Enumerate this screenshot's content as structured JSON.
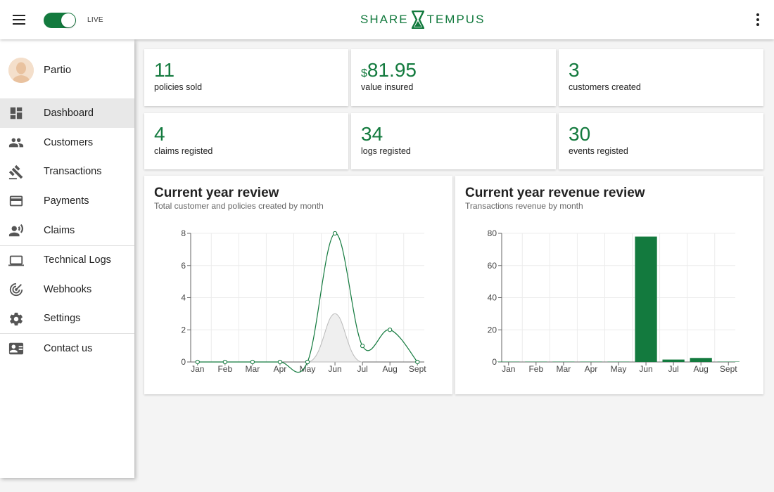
{
  "header": {
    "live_label": "LIVE",
    "logo_left": "SHARE",
    "logo_right": "TEMPUS",
    "live_enabled": true,
    "brand_color": "#137a3e"
  },
  "sidebar": {
    "user_name": "Partio",
    "items": [
      {
        "label": "Dashboard",
        "icon": "dashboard-icon",
        "active": true
      },
      {
        "label": "Customers",
        "icon": "people-icon"
      },
      {
        "label": "Transactions",
        "icon": "gavel-icon"
      },
      {
        "label": "Payments",
        "icon": "credit-card-icon"
      },
      {
        "label": "Claims",
        "icon": "record-voice-icon"
      },
      {
        "label": "Technical Logs",
        "icon": "laptop-icon"
      },
      {
        "label": "Webhooks",
        "icon": "webhook-icon"
      },
      {
        "label": "Settings",
        "icon": "gear-icon"
      },
      {
        "label": "Contact us",
        "icon": "contact-card-icon"
      }
    ]
  },
  "stats": [
    {
      "value": "11",
      "label": "policies sold"
    },
    {
      "currency": "$",
      "value": "81.95",
      "label": "value insured"
    },
    {
      "value": "3",
      "label": "customers created"
    },
    {
      "value": "4",
      "label": "claims registed"
    },
    {
      "value": "34",
      "label": "logs registed"
    },
    {
      "value": "30",
      "label": "events registed"
    }
  ],
  "charts": {
    "review": {
      "title": "Current year review",
      "subtitle": "Total customer and policies created by month"
    },
    "revenue": {
      "title": "Current year revenue review",
      "subtitle": "Transactions revenue by month"
    }
  },
  "chart_data": [
    {
      "type": "line",
      "title": "Current year review",
      "subtitle": "Total customer and policies created by month",
      "categories": [
        "Jan",
        "Feb",
        "Mar",
        "Apr",
        "May",
        "Jun",
        "Jul",
        "Aug",
        "Sept"
      ],
      "series": [
        {
          "values": [
            0,
            0,
            0,
            0,
            0,
            8,
            1,
            2,
            0
          ],
          "color": "#137a3e",
          "style": "line"
        },
        {
          "values": [
            0,
            0,
            0,
            0,
            0,
            3,
            0,
            0,
            0
          ],
          "color": "#bbbbbb",
          "style": "area"
        }
      ],
      "ylim": [
        0,
        8
      ],
      "yticks": [
        0,
        2,
        4,
        6,
        8
      ],
      "grid": true
    },
    {
      "type": "bar",
      "title": "Current year revenue review",
      "subtitle": "Transactions revenue by month",
      "categories": [
        "Jan",
        "Feb",
        "Mar",
        "Apr",
        "May",
        "Jun",
        "Jul",
        "Aug",
        "Sept"
      ],
      "values": [
        0,
        0,
        0,
        0,
        0,
        78,
        1.5,
        2.5,
        0
      ],
      "color": "#137a3e",
      "ylim": [
        0,
        80
      ],
      "yticks": [
        0,
        20,
        40,
        60,
        80
      ],
      "grid": true
    }
  ]
}
